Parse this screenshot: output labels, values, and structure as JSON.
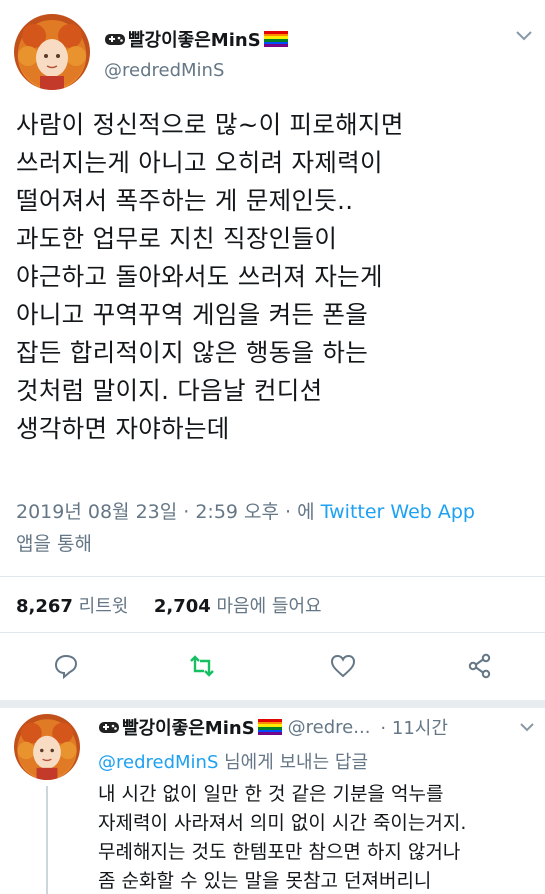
{
  "tweet": {
    "display_name": "빨강이좋은MinS",
    "handle": "@redredMinS",
    "body_lines": [
      "사람이 정신적으로 많~이 피로해지면",
      "쓰러지는게 아니고 오히려 자제력이",
      "떨어져서 폭주하는 게 문제인듯..",
      "과도한 업무로 지친 직장인들이",
      "야근하고 돌아와서도 쓰러져 자는게",
      "아니고 꾸역꾸역 게임을 켜든 폰을",
      "잡든 합리적이지 않은 행동을 하는",
      "것처럼 말이지. 다음날 컨디션",
      "생각하면 자야하는데"
    ],
    "timestamp": "2019년 08월 23일 · 2:59 오후 · 에",
    "source": "Twitter Web App",
    "source_suffix": "앱을 통해",
    "retweet_count": "8,267",
    "retweet_label": "리트윗",
    "like_count": "2,704",
    "like_label": "마음에 들어요"
  },
  "icons": {
    "name_prefix": "gamepad-icon",
    "name_suffix": "rainbow-flag-icon",
    "menu": "chevron-down-icon",
    "reply": "reply-icon",
    "retweet": "retweet-icon",
    "like": "heart-icon",
    "share": "share-icon"
  },
  "colors": {
    "retweet_active": "#17bf63",
    "link": "#1da1f2",
    "secondary_text": "#657786",
    "primary_text": "#14171a",
    "flag": [
      "#e40303",
      "#ff8c00",
      "#ffed00",
      "#008026",
      "#004dff",
      "#750787"
    ]
  },
  "reply": {
    "display_name": "빨강이좋은MinS",
    "handle": "@redre...",
    "time": "· 11시간",
    "replying_mention": "@redredMinS",
    "replying_suffix": " 님에게 보내는 답글",
    "body_lines": [
      "내 시간 없이 일만 한 것 같은 기분을 억누를",
      "자제력이 사라져서 의미 없이 시간 죽이는거지.",
      "무례해지는 것도 한템포만 참으면 하지 않거나",
      "좀 순화할 수 있는 말을 못참고 던져버리니"
    ]
  }
}
